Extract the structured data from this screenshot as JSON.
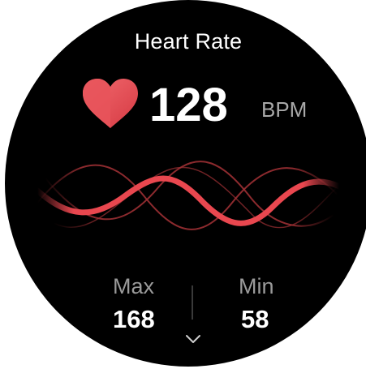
{
  "header": {
    "title": "Heart Rate"
  },
  "reading": {
    "value": "128",
    "unit": "BPM"
  },
  "stats": {
    "max_label": "Max",
    "max_value": "168",
    "min_label": "Min",
    "min_value": "58"
  },
  "icons": {
    "heart": "heart-icon",
    "more": "chevron-down-icon"
  },
  "colors": {
    "accent": "#e9474f",
    "background": "#000000",
    "muted_text": "#9a9a9a"
  }
}
